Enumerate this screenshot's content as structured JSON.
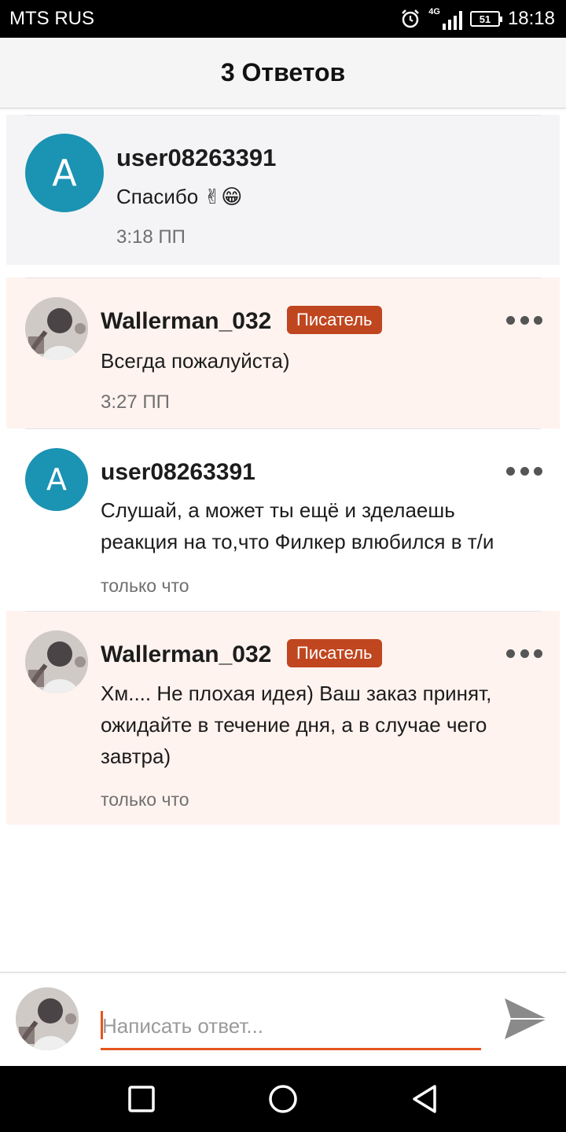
{
  "status_bar": {
    "carrier": "MTS RUS",
    "network": "4G",
    "battery": "51",
    "time": "18:18"
  },
  "header": {
    "title": "3 Ответов"
  },
  "comments": [
    {
      "author": "user08263391",
      "avatar_letter": "A",
      "text": "Спасибо ✌😁",
      "time": "3:18 ПП",
      "highlighted": true
    },
    {
      "author": "Wallerman_032",
      "badge": "Писатель",
      "text": "Всегда пожалуйста)",
      "time": "3:27 ПП"
    },
    {
      "author": "user08263391",
      "avatar_letter": "A",
      "text_lines": [
        "Слушай, а может ты ещё и зделаешь",
        "реакция на то,что Филкер влюбился в т/и"
      ],
      "time": "только что"
    },
    {
      "author": "Wallerman_032",
      "badge": "Писатель",
      "text_lines": [
        "Хм.... Не плохая идея) Ваш заказ принят,",
        "ожидайте в течение дня, а в случае чего",
        "завтра)"
      ],
      "time": "только что"
    }
  ],
  "reply": {
    "placeholder": "Написать ответ..."
  },
  "colors": {
    "accent": "#e4551e",
    "badge": "#c0461f",
    "avatar": "#1b93b3",
    "writer_bg": "#fff3ef",
    "original_bg": "#f4f4f6"
  },
  "icons": [
    "alarm-icon",
    "signal-icon",
    "battery-icon",
    "more-options-icon",
    "send-icon",
    "nav-recents-icon",
    "nav-home-icon",
    "nav-back-icon"
  ]
}
